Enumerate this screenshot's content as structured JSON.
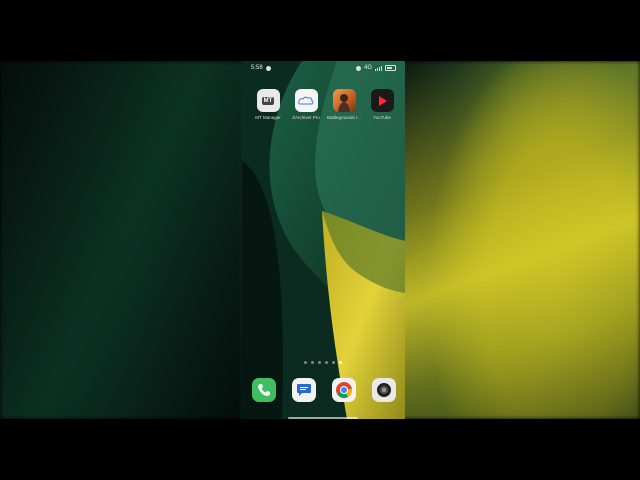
{
  "status_bar": {
    "time": "5:58",
    "network": "4G"
  },
  "home_apps": [
    {
      "label": "MT Manager",
      "icon": "mt-manager-icon",
      "badge": "MT"
    },
    {
      "label": "ZArchiver Pro",
      "icon": "cloud-app-icon"
    },
    {
      "label": "Battlegrounds I...",
      "icon": "battlegrounds-icon"
    },
    {
      "label": "YouTube",
      "icon": "play-icon"
    }
  ],
  "dock_apps": [
    {
      "icon": "phone-icon"
    },
    {
      "icon": "messages-icon"
    },
    {
      "icon": "chrome-icon"
    },
    {
      "icon": "camera-icon"
    }
  ],
  "pager": {
    "pages": 6,
    "active_index": 5
  },
  "colors": {
    "wallpaper_green": "#0c2e22",
    "wallpaper_yellow": "#d8c62a",
    "phone_green": "#3fbf62"
  }
}
